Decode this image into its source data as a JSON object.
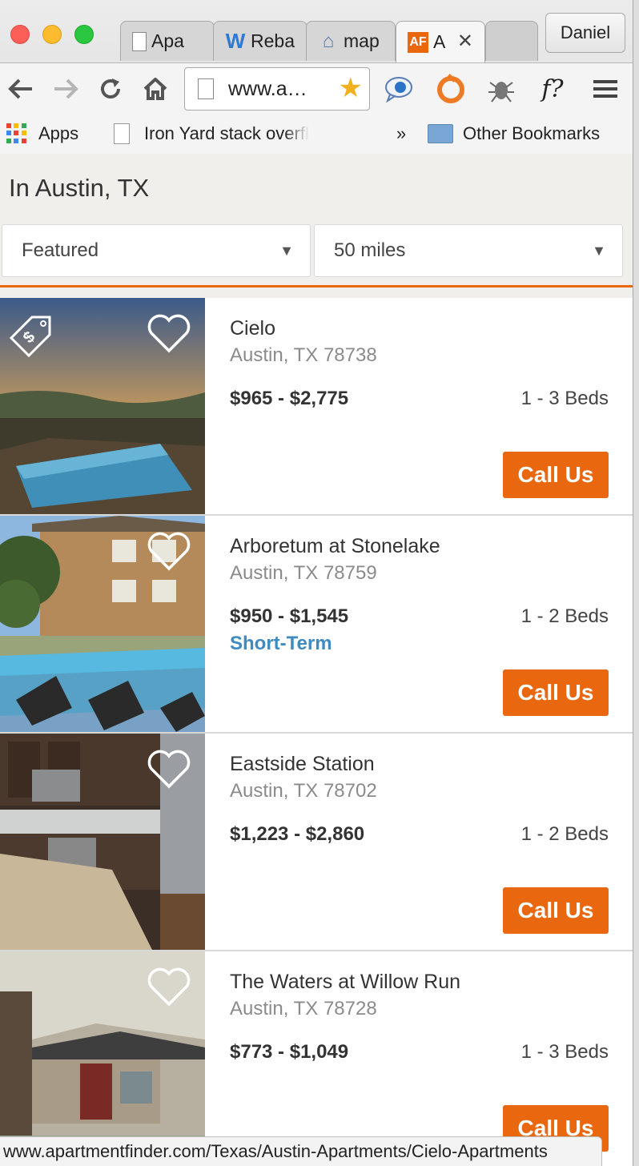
{
  "browser": {
    "tabs": [
      {
        "label": "Apa",
        "icon": "doc"
      },
      {
        "label": "Reba",
        "icon": "w"
      },
      {
        "label": "map",
        "icon": "map"
      },
      {
        "label": "A",
        "icon": "af",
        "favicon_text": "AF",
        "close": "✕"
      }
    ],
    "profile": "Daniel",
    "url": "www.a…",
    "bookmarks": {
      "apps": "Apps",
      "item1": "Iron Yard stack overfl",
      "overflow": "»",
      "other": "Other Bookmarks"
    },
    "status_url": "www.apartmentfinder.com/Texas/Austin-Apartments/Cielo-Apartments"
  },
  "page": {
    "location_title": "In Austin, TX",
    "sort_select": "Featured",
    "radius_select": "50 miles"
  },
  "listings": [
    {
      "name": "Cielo",
      "address": "Austin, TX 78738",
      "price": "$965 - $2,775",
      "beds": "1 - 3 Beds",
      "badge": "",
      "cta": "Call Us",
      "deal_tag": "$"
    },
    {
      "name": "Arboretum at Stonelake",
      "address": "Austin, TX 78759",
      "price": "$950 - $1,545",
      "beds": "1 - 2 Beds",
      "badge": "Short-Term",
      "cta": "Call Us"
    },
    {
      "name": "Eastside Station",
      "address": "Austin, TX 78702",
      "price": "$1,223 - $2,860",
      "beds": "1 - 2 Beds",
      "badge": "",
      "cta": "Call Us"
    },
    {
      "name": "The Waters at Willow Run",
      "address": "Austin, TX 78728",
      "price": "$773 - $1,049",
      "beds": "1 - 3 Beds",
      "badge": "",
      "cta": "Call Us"
    }
  ],
  "colors": {
    "accent": "#e8670f",
    "short_term": "#3f8ac0"
  }
}
